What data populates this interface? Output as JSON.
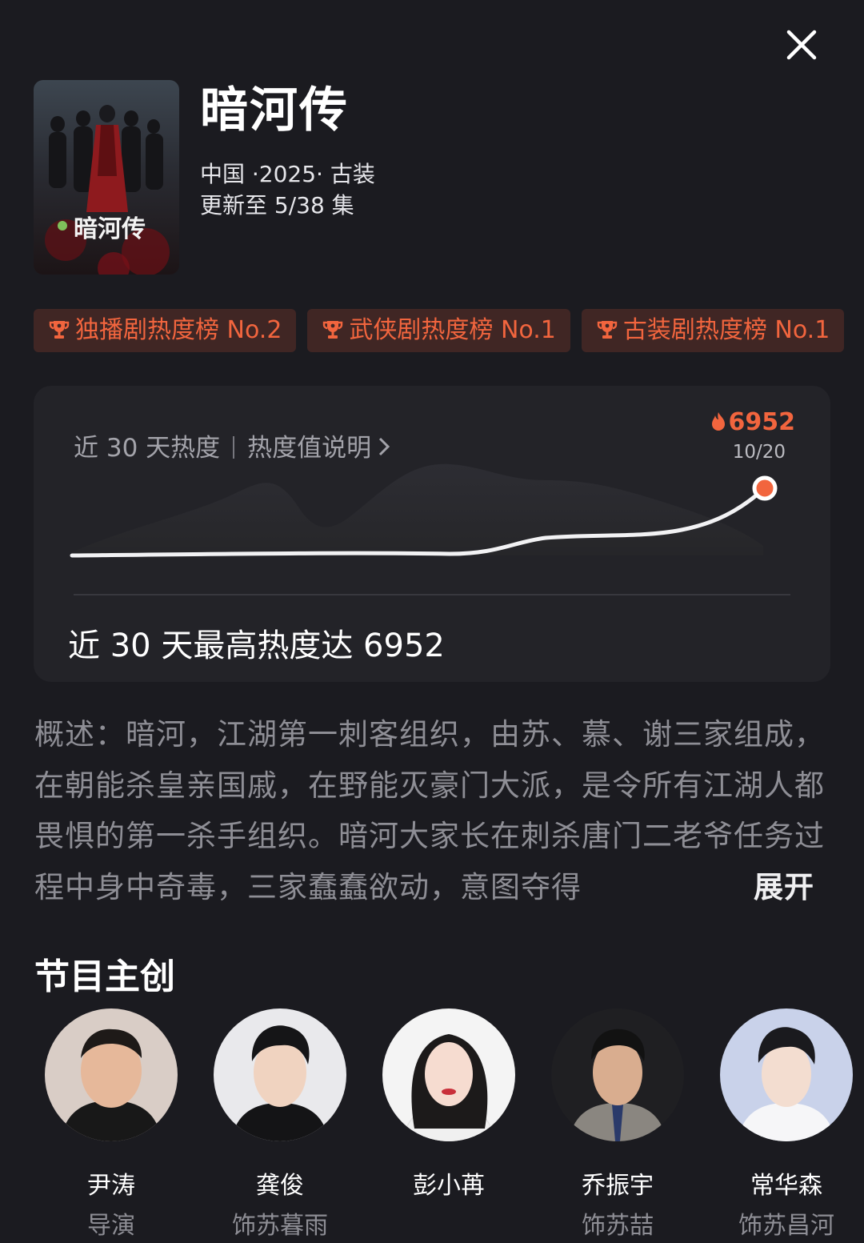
{
  "show": {
    "title": "暗河传",
    "poster_title": "暗河传",
    "meta_line1": "中国 ·2025· 古装",
    "meta_line2": "更新至 5/38 集"
  },
  "badges": [
    {
      "label": "独播剧热度榜 No.2",
      "icon": "trophy-icon"
    },
    {
      "label": "武侠剧热度榜 No.1",
      "icon": "trophy-icon"
    },
    {
      "label": "古装剧热度榜 No.1",
      "icon": "trophy-icon"
    }
  ],
  "heat": {
    "header_label": "近 30 天热度",
    "explain_link": "热度值说明",
    "peak_value": "6952",
    "peak_date": "10/20",
    "summary": "近 30 天最高热度达 6952",
    "accent_color": "#f2653e"
  },
  "synopsis": {
    "text": "概述：暗河，江湖第一刺客组织，由苏、慕、谢三家组成，在朝能杀皇亲国戚，在野能灭豪门大派，是令所有江湖人都畏惧的第一杀手组织。暗河大家长在刺杀唐门二老爷任务过程中身中奇毒，三家蠢蠢欲动，意图夺得",
    "expand_label": "展开"
  },
  "creators": {
    "section_title": "节目主创",
    "members": [
      {
        "name": "尹涛",
        "role": "导演"
      },
      {
        "name": "龚俊",
        "role": "饰苏暮雨"
      },
      {
        "name": "彭小苒",
        "role": ""
      },
      {
        "name": "乔振宇",
        "role": "饰苏喆"
      },
      {
        "name": "常华森",
        "role": "饰苏昌河"
      }
    ]
  },
  "icons": {
    "close": "close-icon",
    "chevron": "chevron-right-icon",
    "flame": "flame-icon"
  }
}
